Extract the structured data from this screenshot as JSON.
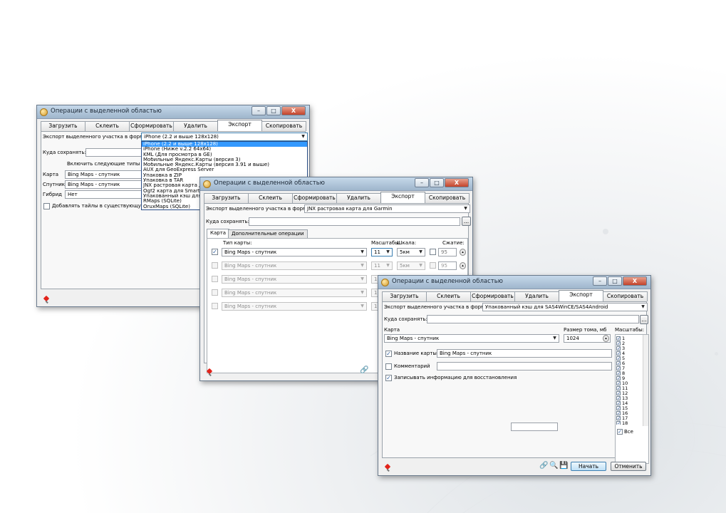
{
  "win1": {
    "title": "Операции с выделенной областью",
    "tabs": [
      "Загрузить",
      "Склеить",
      "Сформировать",
      "Удалить",
      "Экспорт",
      "Скопировать"
    ],
    "export_label": "Экспорт выделенного участка в формат",
    "format_value": "iPhone (2.2 и выше 128х128)",
    "format_options": [
      "iPhone (2.2 и выше 128х128)",
      "iPhone (Ниже v.2.2 64х64)",
      "KML (Для просмотра в GE)",
      "Мобильные Яндекс.Карты (версия 3)",
      "Мобильные Яндекс.Карты (версия 3.91 и выше)",
      "AUX для GeoExpress Server",
      "Упаковка в ZIP",
      "Упаковка в TAR",
      "JNX растровая карта для Garmin",
      "Ogf2 карта для SmartComGPS",
      "Упакованный кэш для SAS4WinCE/SAS4Android",
      "RMaps (SQLite)",
      "OruxMaps (SQLite)"
    ],
    "save_label": "Куда сохранять:",
    "include_label": "Включить следующие типы карт",
    "rows": [
      {
        "label": "Карта",
        "value": "Bing Maps - спутник"
      },
      {
        "label": "Спутник",
        "value": "Bing Maps - спутник"
      },
      {
        "label": "Гибрид",
        "value": "Нет"
      }
    ],
    "append_label": "Добавлять тайлы в существующую БД"
  },
  "win2": {
    "title": "Операции с выделенной областью",
    "tabs": [
      "Загрузить",
      "Склеить",
      "Сформировать",
      "Удалить",
      "Экспорт",
      "Скопировать"
    ],
    "export_label": "Экспорт выделенного участка в формат",
    "format_value": "JNX растровая карта для Garmin",
    "save_label": "Куда сохранять:",
    "browse_label": "...",
    "subtabs": [
      "Карта",
      "Дополнительные операции"
    ],
    "head_map": "Тип карты:",
    "head_scales": "Масштабы:",
    "head_scale": "Шкала:",
    "head_compress": "Сжатие:",
    "rows": [
      {
        "map": "Bing Maps - спутник",
        "zoom": "11",
        "scale": "5км",
        "q": "95",
        "checked": true,
        "enabled": true
      },
      {
        "map": "Bing Maps - спутник",
        "zoom": "11",
        "scale": "5км",
        "q": "95",
        "checked": false,
        "enabled": false
      },
      {
        "map": "Bing Maps - спутник",
        "zoom": "11",
        "checked": false,
        "enabled": false
      },
      {
        "map": "Bing Maps - спутник",
        "zoom": "11",
        "checked": false,
        "enabled": false
      },
      {
        "map": "Bing Maps - спутник",
        "zoom": "11",
        "checked": false,
        "enabled": false
      }
    ]
  },
  "win3": {
    "title": "Операции с выделенной областью",
    "tabs": [
      "Загрузить",
      "Склеить",
      "Сформировать",
      "Удалить",
      "Экспорт",
      "Скопировать"
    ],
    "export_label": "Экспорт выделенного участка в формат",
    "format_value": "Упакованный кэш для SAS4WinCE/SAS4Android",
    "save_label": "Куда сохранять:",
    "browse_label": "...",
    "map_label": "Карта",
    "map_value": "Bing Maps - спутник",
    "volume_label": "Размер тома, мб",
    "volume_value": "1024",
    "scales_label": "Масштабы:",
    "scales": [
      "1",
      "2",
      "3",
      "4",
      "5",
      "6",
      "7",
      "8",
      "9",
      "10",
      "11",
      "12",
      "13",
      "14",
      "15",
      "16",
      "17",
      "18"
    ],
    "map_name_label": "Название карты",
    "map_name_value": "Bing Maps - спутник",
    "comment_label": "Комментарий",
    "recovery_label": "Записывать информацию для восстановления",
    "all_label": "Все",
    "start_label": "Начать",
    "cancel_label": "Отменить"
  },
  "window_buttons": {
    "minimize": "–",
    "maximize": "□",
    "close": "X"
  }
}
